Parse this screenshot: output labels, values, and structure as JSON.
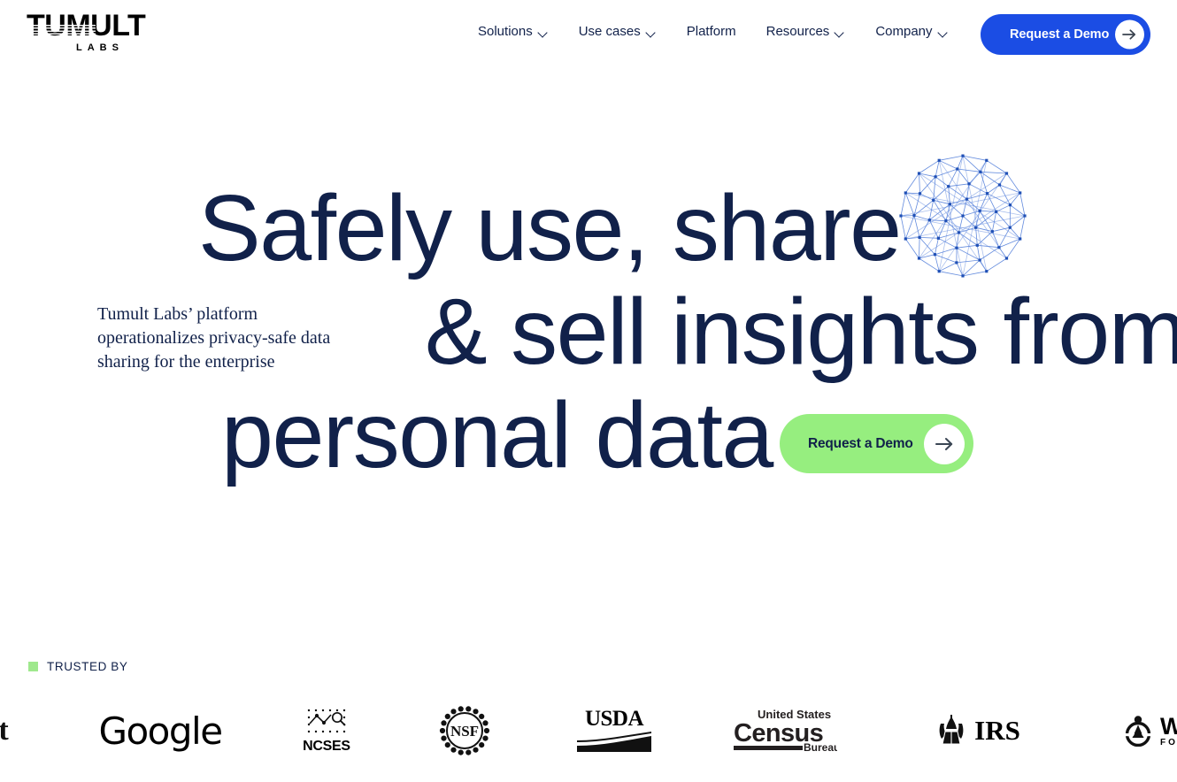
{
  "header": {
    "logo": {
      "word": "TUMULT",
      "sub": "LABS",
      "icon": "tumult-labs-logo"
    },
    "nav": [
      {
        "label": "Solutions",
        "has_chevron": true
      },
      {
        "label": "Use cases",
        "has_chevron": true
      },
      {
        "label": "Platform",
        "has_chevron": false
      },
      {
        "label": "Resources",
        "has_chevron": true
      },
      {
        "label": "Company",
        "has_chevron": true
      }
    ],
    "cta": {
      "label": "Request a Demo",
      "bg_color": "#1B4DE4",
      "text_color": "#FFFFFF",
      "icon": "arrow-right-icon"
    }
  },
  "hero": {
    "headline_lines": [
      "Safely use, share",
      "& sell insights from",
      "personal data"
    ],
    "headline_color": "#11214a",
    "subcopy": "Tumult Labs’ platform operationalizes privacy-safe data sharing for the enterprise",
    "cta": {
      "label": "Request a Demo",
      "bg_color": "#96EE7F",
      "text_color": "#11214a",
      "icon": "arrow-right-icon"
    },
    "decoration": {
      "name": "network-sphere-graphic",
      "color": "#2b5fd0"
    }
  },
  "trusted": {
    "bullet_color": "#9FE88D",
    "label": "TRUSTED BY",
    "logos": [
      {
        "name": "cut-off-logo",
        "text": "t"
      },
      {
        "name": "google-logo",
        "text": "Google"
      },
      {
        "name": "ncses-logo",
        "text": "NCSES"
      },
      {
        "name": "nsf-logo",
        "text": "NSF"
      },
      {
        "name": "usda-logo",
        "text": "USDA"
      },
      {
        "name": "census-bureau-logo",
        "line1": "United States",
        "line2": "Census",
        "line3": "Bureau"
      },
      {
        "name": "irs-logo",
        "text": "IRS"
      },
      {
        "name": "wikimedia-foundation-logo",
        "text": "WI",
        "sub": "FO"
      }
    ]
  }
}
